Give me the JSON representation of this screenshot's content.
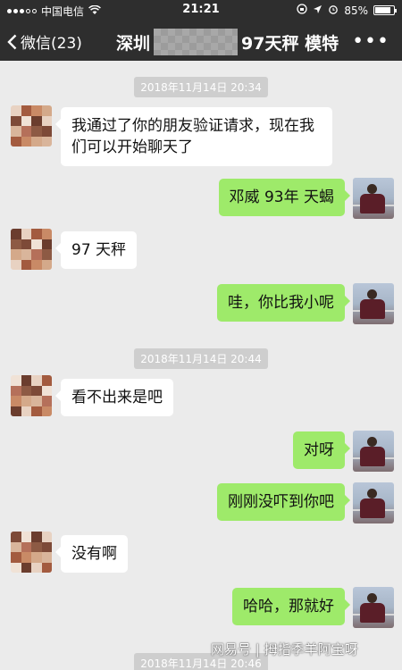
{
  "status": {
    "carrier": "中国电信",
    "time": "21:21",
    "battery": "85%",
    "battery_level": 0.85
  },
  "nav": {
    "back_label": "微信(23)",
    "title_prefix": "深圳",
    "title_suffix": "97天秤 模特",
    "more": "•••"
  },
  "timestamps": [
    "2018年11月14日 20:34",
    "2018年11月14日 20:44",
    "2018年11月14日 20:46"
  ],
  "messages": [
    {
      "from": "them",
      "text": "我通过了你的朋友验证请求，现在我们可以开始聊天了"
    },
    {
      "from": "me",
      "text": "邓威   93年   天蝎"
    },
    {
      "from": "them",
      "text": "97 天秤"
    },
    {
      "from": "me",
      "text": "哇，你比我小呢"
    },
    {
      "from": "them",
      "text": "看不出来是吧"
    },
    {
      "from": "me",
      "text": "对呀"
    },
    {
      "from": "me",
      "text": "刚刚没吓到你吧"
    },
    {
      "from": "them",
      "text": "没有啊"
    },
    {
      "from": "me",
      "text": "哈哈，那就好"
    }
  ],
  "watermark": "网易号 | 拇指季羊阿宝呀",
  "colors": {
    "nav_bg": "#2e2e2e",
    "chat_bg": "#ebebeb",
    "bubble_out": "#9eea6a",
    "bubble_in": "#ffffff"
  }
}
